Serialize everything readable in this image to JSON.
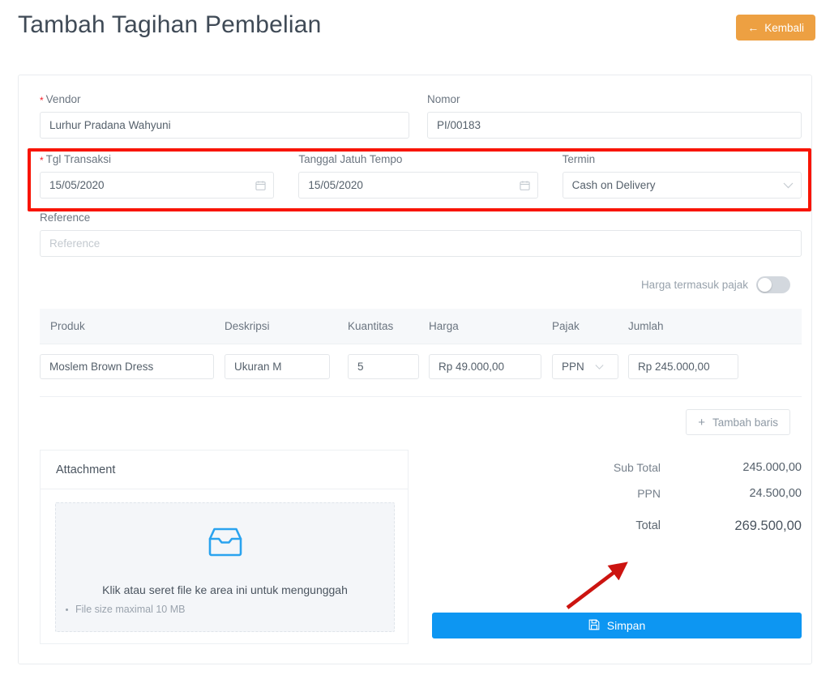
{
  "header": {
    "title": "Tambah Tagihan Pembelian",
    "back_button": {
      "label": "Kembali",
      "icon": "arrow-left-icon",
      "color": "#eda042"
    }
  },
  "form": {
    "vendor": {
      "label": "Vendor",
      "required": true,
      "value": "Lurhur Pradana Wahyuni"
    },
    "nomor": {
      "label": "Nomor",
      "required": false,
      "value": "PI/00183"
    },
    "tgl_transaksi": {
      "label": "Tgl Transaksi",
      "required": true,
      "value": "15/05/2020",
      "icon": "calendar-icon"
    },
    "jatuh_tempo": {
      "label": "Tanggal Jatuh Tempo",
      "required": false,
      "value": "15/05/2020",
      "icon": "calendar-icon"
    },
    "termin": {
      "label": "Termin",
      "required": false,
      "value": "Cash on Delivery",
      "icon": "chevron-down-icon"
    },
    "reference": {
      "label": "Reference",
      "required": false,
      "value": "",
      "placeholder": "Reference"
    },
    "required_marker": "*"
  },
  "tax_toggle": {
    "label": "Harga termasuk pajak",
    "state": "off"
  },
  "items_table": {
    "columns": [
      "Produk",
      "Deskripsi",
      "Kuantitas",
      "Harga",
      "Pajak",
      "Jumlah"
    ],
    "rows": [
      {
        "produk": "Moslem Brown Dress",
        "deskripsi": "Ukuran M",
        "kuantitas": "5",
        "harga": "Rp 49.000,00",
        "pajak": "PPN",
        "jumlah": "Rp 245.000,00"
      }
    ],
    "add_row_button": {
      "label": "Tambah baris",
      "icon": "plus-icon"
    }
  },
  "attachment": {
    "title": "Attachment",
    "icon": "inbox-tray-icon",
    "icon_color": "#2aa3ef",
    "drop_text": "Klik atau seret file ke area ini untuk mengunggah",
    "note": "File size maximal 10 MB"
  },
  "totals": {
    "sub_total": {
      "label": "Sub Total",
      "value": "245.000,00"
    },
    "ppn": {
      "label": "PPN",
      "value": "24.500,00"
    },
    "total": {
      "label": "Total",
      "value": "269.500,00"
    }
  },
  "save_button": {
    "label": "Simpan",
    "icon": "save-icon",
    "color": "#0d96f2"
  },
  "annotations": {
    "highlight_box_color": "#f81403",
    "arrow_color": "#cc1410"
  }
}
